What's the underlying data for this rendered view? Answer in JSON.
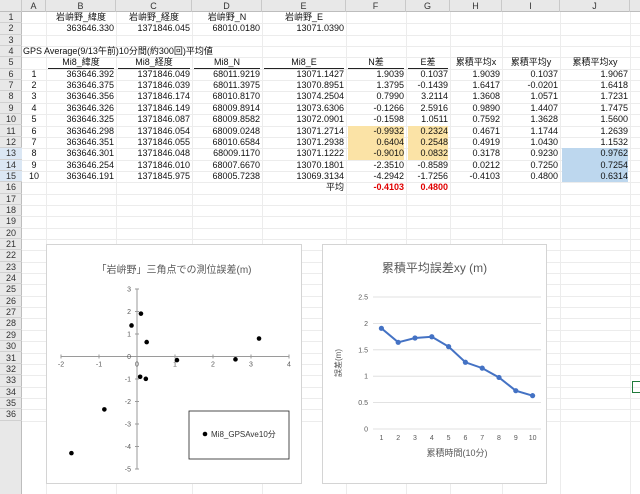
{
  "columns": [
    "A",
    "B",
    "C",
    "D",
    "E",
    "F",
    "G",
    "H",
    "I",
    "J"
  ],
  "rows": [
    "1",
    "2",
    "3",
    "4",
    "5",
    "6",
    "7",
    "8",
    "9",
    "10",
    "11",
    "12",
    "13",
    "14",
    "15",
    "16",
    "17",
    "18",
    "19",
    "20",
    "21",
    "22",
    "23",
    "24",
    "25",
    "26",
    "27",
    "28",
    "29",
    "30",
    "31",
    "32",
    "33",
    "34",
    "35",
    "36"
  ],
  "header_row1": [
    "岩峅野_緯度",
    "岩峅野_経度",
    "岩峅野_N",
    "岩峅野_E"
  ],
  "header_row2": [
    "363646.330",
    "1371846.045",
    "68010.0180",
    "13071.0390"
  ],
  "section_title": "GPS Average(9/13午前)10分間(約300回)平均値",
  "table_headers": [
    "Mi8_緯度",
    "Mi8_経度",
    "Mi8_N",
    "Mi8_E",
    "N差",
    "E差",
    "累積平均x",
    "累積平均y",
    "累積平均xy"
  ],
  "table_rows": [
    [
      "1",
      "363646.392",
      "1371846.049",
      "68011.9219",
      "13071.1427",
      "1.9039",
      "0.1037",
      "1.9039",
      "0.1037",
      "1.9067"
    ],
    [
      "2",
      "363646.375",
      "1371846.039",
      "68011.3975",
      "13070.8951",
      "1.3795",
      "-0.1439",
      "1.6417",
      "-0.0201",
      "1.6418"
    ],
    [
      "3",
      "363646.356",
      "1371846.174",
      "68010.8170",
      "13074.2504",
      "0.7990",
      "3.2114",
      "1.3608",
      "1.0571",
      "1.7231"
    ],
    [
      "4",
      "363646.326",
      "1371846.149",
      "68009.8914",
      "13073.6306",
      "-0.1266",
      "2.5916",
      "0.9890",
      "1.4407",
      "1.7475"
    ],
    [
      "5",
      "363646.325",
      "1371846.087",
      "68009.8582",
      "13072.0901",
      "-0.1598",
      "1.0511",
      "0.7592",
      "1.3628",
      "1.5600"
    ],
    [
      "6",
      "363646.298",
      "1371846.054",
      "68009.0248",
      "13071.2714",
      "-0.9932",
      "0.2324",
      "0.4671",
      "1.1744",
      "1.2639"
    ],
    [
      "7",
      "363646.351",
      "1371846.055",
      "68010.6584",
      "13071.2938",
      "0.6404",
      "0.2548",
      "0.4919",
      "1.0430",
      "1.1532"
    ],
    [
      "8",
      "363646.301",
      "1371846.048",
      "68009.1170",
      "13071.1222",
      "-0.9010",
      "0.0832",
      "0.3178",
      "0.9230",
      "0.9762"
    ],
    [
      "9",
      "363646.254",
      "1371846.010",
      "68007.6670",
      "13070.1801",
      "-2.3510",
      "-0.8589",
      "0.0212",
      "0.7250",
      "0.7254"
    ],
    [
      "10",
      "363646.191",
      "1371845.975",
      "68005.7238",
      "13069.3134",
      "-4.2942",
      "-1.7256",
      "-0.4103",
      "0.4800",
      "0.6314"
    ]
  ],
  "avg_label": "平均",
  "avg_values": [
    "-0.4103",
    "0.4800"
  ],
  "colors": {
    "yellow_fill": "#fbe3a6",
    "blue_fill": "#bdd7ee",
    "red_text": "#e00000",
    "line_series": "#4472c4",
    "scatter_points": "#000000"
  },
  "charts": {
    "scatter": {
      "title": "「岩峅野」三角点での測位誤差(m)",
      "legend": "Mi8_GPSAve10分",
      "x_ticks": [
        "-2",
        "-1",
        "0",
        "1",
        "2",
        "3",
        "4"
      ],
      "y_ticks": [
        "3",
        "2",
        "1",
        "0",
        "-1",
        "-2",
        "-3",
        "-4",
        "-5"
      ]
    },
    "line": {
      "title": "累積平均誤差xy (m)",
      "ylabel": "誤差(m)",
      "xlabel": "累積時間(10分)",
      "y_ticks": [
        "2.5",
        "2",
        "1.5",
        "1",
        "0.5",
        "0"
      ],
      "x_ticks": [
        "1",
        "2",
        "3",
        "4",
        "5",
        "6",
        "7",
        "8",
        "9",
        "10"
      ]
    }
  },
  "chart_data": [
    {
      "type": "scatter",
      "title": "「岩峅野」三角点での測位誤差(m)",
      "series": [
        {
          "name": "Mi8_GPSAve10分",
          "x": [
            0.1037,
            -0.1439,
            3.2114,
            2.5916,
            1.0511,
            0.2324,
            0.2548,
            0.0832,
            -0.8589,
            -1.7256
          ],
          "y": [
            1.9039,
            1.3795,
            0.799,
            -0.1266,
            -0.1598,
            -0.9932,
            0.6404,
            -0.901,
            -2.351,
            -4.2942
          ]
        }
      ],
      "xlim": [
        -2,
        4
      ],
      "ylim": [
        -5,
        3
      ],
      "legend": "bottom-right"
    },
    {
      "type": "line",
      "title": "累積平均誤差xy (m)",
      "xlabel": "累積時間(10分)",
      "ylabel": "誤差(m)",
      "categories": [
        "1",
        "2",
        "3",
        "4",
        "5",
        "6",
        "7",
        "8",
        "9",
        "10"
      ],
      "values": [
        1.9067,
        1.6418,
        1.7231,
        1.7475,
        1.56,
        1.2639,
        1.1532,
        0.9762,
        0.7254,
        0.6314
      ],
      "ylim": [
        0,
        2.5
      ],
      "grid": true
    }
  ]
}
